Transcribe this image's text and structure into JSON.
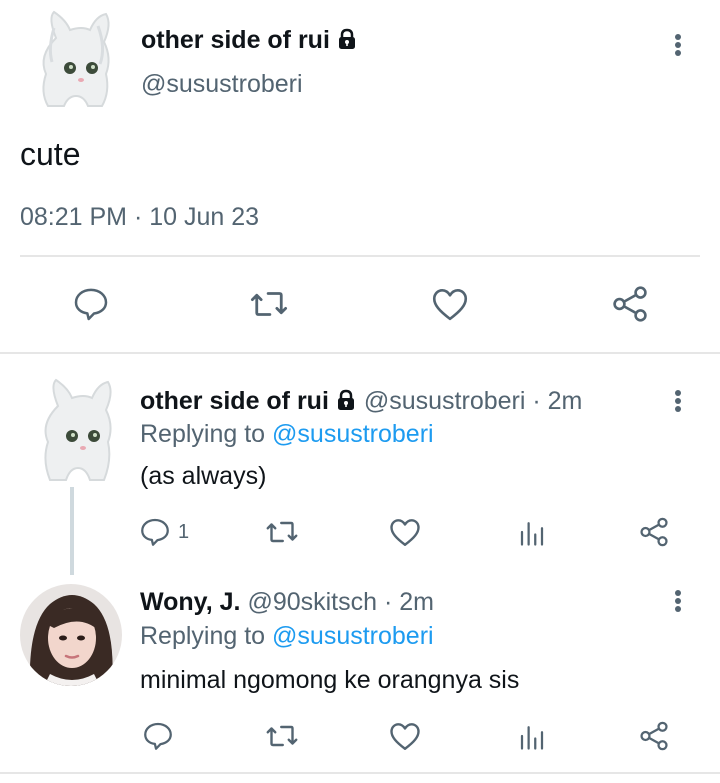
{
  "main_tweet": {
    "display_name": "other side of rui",
    "handle": "@susustroberi",
    "text": "cute",
    "time": "08:21 PM",
    "date": "10 Jun 23"
  },
  "replies": [
    {
      "display_name": "other side of rui",
      "handle": "@susustroberi",
      "age": "2m",
      "replying_label": "Replying to",
      "replying_to": "@susustroberi",
      "text": "(as always)",
      "reply_count": "1"
    },
    {
      "display_name": "Wony, J.",
      "handle": "@90skitsch",
      "age": "2m",
      "replying_label": "Replying to",
      "replying_to": "@susustroberi",
      "text": "minimal ngomong ke orangnya sis"
    }
  ],
  "separator": "·",
  "colors": {
    "text": "#0f1419",
    "secondary": "#536471",
    "link": "#1d9bf0",
    "divider": "#e6e6e6"
  },
  "icons": [
    "lock-icon",
    "more-icon",
    "reply-icon",
    "retweet-icon",
    "like-icon",
    "share-icon",
    "analytics-icon"
  ]
}
